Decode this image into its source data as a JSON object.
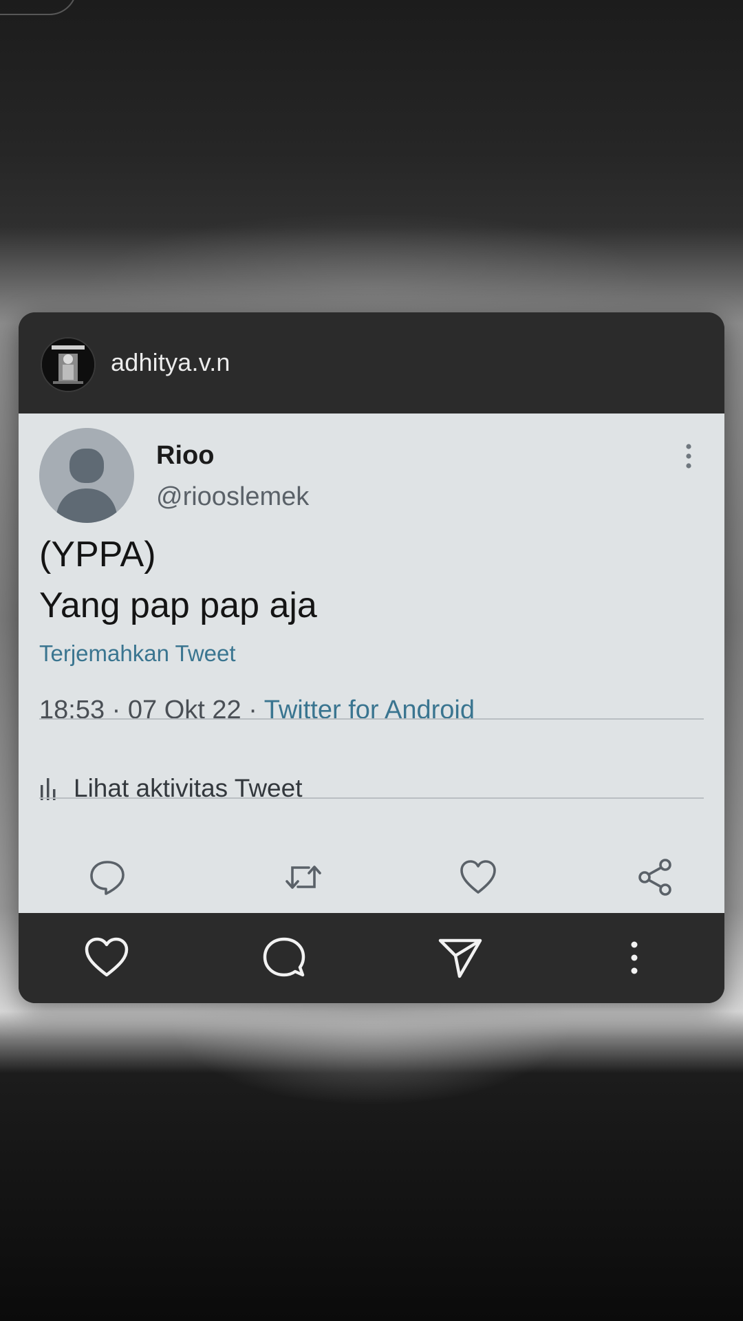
{
  "post": {
    "username": "adhitya.v.n",
    "avatar_icon": "profile-logo-icon"
  },
  "tweet": {
    "display_name": "Rioo",
    "handle": "@riooslemek",
    "text": "(YPPA)\nYang pap pap aja",
    "translate_label": "Terjemahkan Tweet",
    "time": "18:53",
    "date": "07 Okt 22",
    "separator": "·",
    "source": "Twitter for Android",
    "activity_label": "Lihat aktivitas Tweet",
    "actions": [
      "reply-icon",
      "retweet-icon",
      "like-icon",
      "share-icon"
    ]
  },
  "footer": {
    "actions": [
      "heart-icon",
      "comment-icon",
      "send-icon",
      "more-icon"
    ]
  },
  "colors": {
    "card_dark": "#2b2b2b",
    "tweet_bg": "#dfe3e5",
    "link": "#3a7590"
  }
}
